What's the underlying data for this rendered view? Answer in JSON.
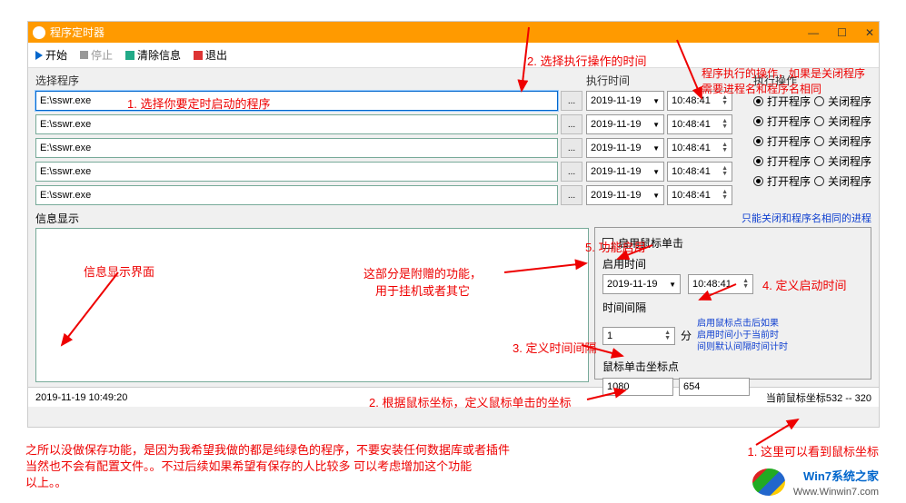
{
  "title": "程序定时器",
  "toolbar": {
    "start": "开始",
    "stop": "停止",
    "clear": "清除信息",
    "exit": "退出"
  },
  "headers": {
    "program": "选择程序",
    "exec_time": "执行时间",
    "exec_op": "执行操作"
  },
  "rows": [
    {
      "path": "E:\\sswr.exe",
      "date": "2019-11-19",
      "time": "10:48:41",
      "op": "open",
      "selected": true
    },
    {
      "path": "E:\\sswr.exe",
      "date": "2019-11-19",
      "time": "10:48:41",
      "op": "open"
    },
    {
      "path": "E:\\sswr.exe",
      "date": "2019-11-19",
      "time": "10:48:41",
      "op": "open"
    },
    {
      "path": "E:\\sswr.exe",
      "date": "2019-11-19",
      "time": "10:48:41",
      "op": "open"
    },
    {
      "path": "E:\\sswr.exe",
      "date": "2019-11-19",
      "time": "10:48:41",
      "op": "open"
    }
  ],
  "op_labels": {
    "open": "打开程序",
    "close": "关闭程序"
  },
  "browse_btn": "...",
  "info_label": "信息显示",
  "note": "只能关闭和程序名相同的进程",
  "click": {
    "enable": "启用鼠标单击",
    "enable_time_label": "启用时间",
    "date": "2019-11-19",
    "time": "10:48:41",
    "interval_label": "时间间隔",
    "interval_value": "1",
    "interval_unit": "分",
    "help": "启用鼠标点击后如果\n启用时间小于当前时\n间则默认间隔时间计时",
    "coord_label": "鼠标单击坐标点",
    "coord_x": "1080",
    "coord_y": "654"
  },
  "status": {
    "left": "2019-11-19 10:49:20",
    "right": "当前鼠标坐标532 -- 320"
  },
  "annotations": {
    "a1": "1. 选择你要定时启动的程序",
    "a2": "2. 选择执行操作的时间",
    "a3": "程序执行的操作，如果是关闭程序\n需要进程名和程序名相同",
    "a4": "信息显示界面",
    "a5": "这部分是附赠的功能，\n用于挂机或者其它",
    "a6": "5. 功能启用",
    "a7": "4. 定义启动时间",
    "a8": "3. 定义时间间隔",
    "a9": "2. 根据鼠标坐标，定义鼠标单击的坐标",
    "a10": "1. 这里可以看到鼠标坐标"
  },
  "footer": "之所以没做保存功能，是因为我希望我做的都是纯绿色的程序，不要安装任何数据库或者插件\n当然也不会有配置文件。。不过后续如果希望有保存的人比较多 可以考虑增加这个功能\n以上。。",
  "watermark": {
    "line1": "Win7系统之家",
    "line2": "Www.Winwin7.com"
  }
}
